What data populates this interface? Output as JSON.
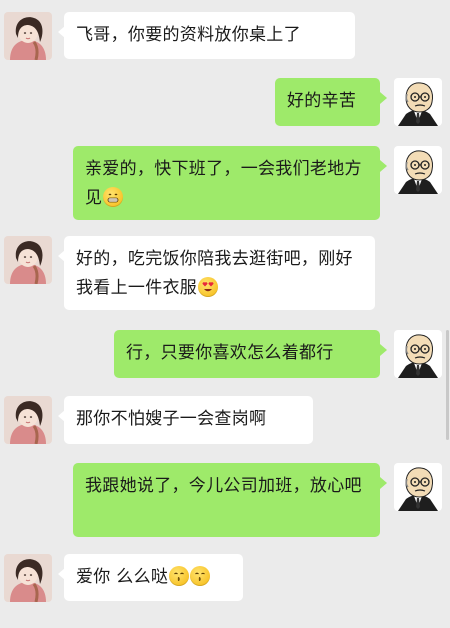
{
  "messages": [
    {
      "side": "left",
      "sender": "girl",
      "text": "飞哥，你要的资料放你桌上了",
      "emoji": []
    },
    {
      "side": "right",
      "sender": "boss",
      "text": "好的辛苦",
      "emoji": []
    },
    {
      "side": "right",
      "sender": "boss",
      "text": "亲爱的，快下班了，一会我们老地方见",
      "emoji": [
        "grin-emoji"
      ]
    },
    {
      "side": "left",
      "sender": "girl",
      "text": "好的，吃完饭你陪我去逛街吧，刚好我看上一件衣服",
      "emoji": [
        "heart-eyes-emoji"
      ]
    },
    {
      "side": "right",
      "sender": "boss",
      "text": "行，只要你喜欢怎么着都行",
      "emoji": []
    },
    {
      "side": "left",
      "sender": "girl",
      "text": "那你不怕嫂子一会查岗啊",
      "emoji": []
    },
    {
      "side": "right",
      "sender": "boss",
      "text": "我跟她说了，今儿公司加班，放心吧",
      "emoji": []
    },
    {
      "side": "left",
      "sender": "girl",
      "text": "爱你 么么哒",
      "emoji": [
        "kiss-emoji",
        "kiss-emoji"
      ]
    }
  ],
  "colors": {
    "background": "#ebebeb",
    "left_bubble": "#ffffff",
    "right_bubble": "#9eea6a"
  }
}
